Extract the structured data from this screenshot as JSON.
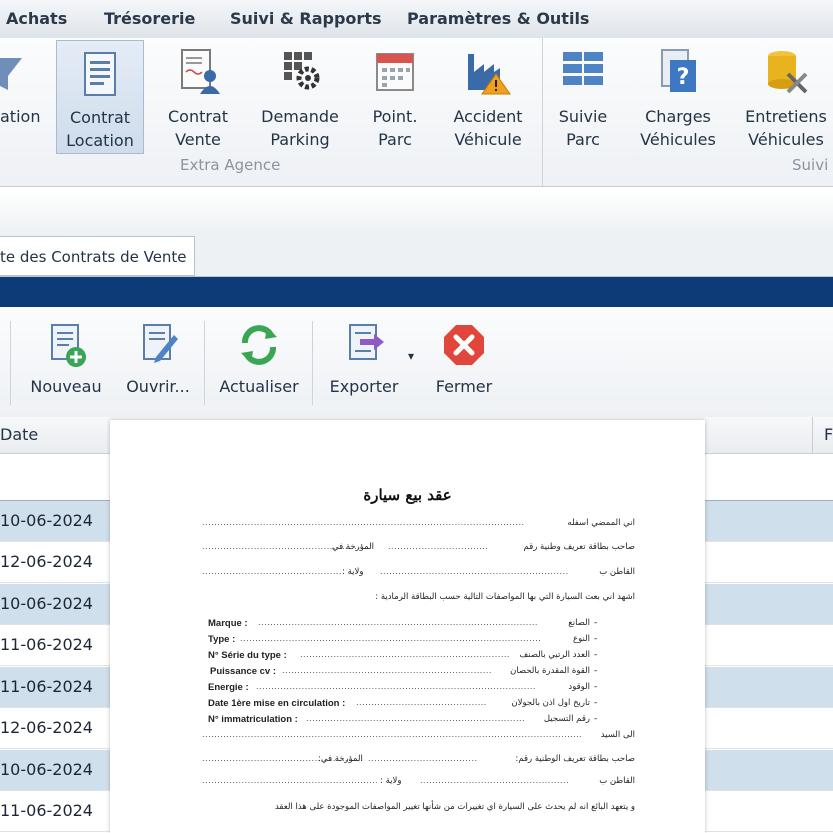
{
  "menu": [
    "Achats",
    "Trésorerie",
    "Suivi & Rapports",
    "Paramètres & Outils"
  ],
  "ribbon": {
    "partial_label": "ation",
    "buttons": [
      {
        "line1": "Contrat",
        "line2": "Location",
        "icon": "document-icon"
      },
      {
        "line1": "Contrat",
        "line2": "Vente",
        "icon": "contract-person-icon"
      },
      {
        "line1": "Demande",
        "line2": "Parking",
        "icon": "parking-gear-icon"
      },
      {
        "line1": "Point.",
        "line2": "Parc",
        "icon": "calendar-icon"
      },
      {
        "line1": "Accident",
        "line2": "Véhicule",
        "icon": "factory-warning-icon"
      },
      {
        "line1": "Suivie",
        "line2": "Parc",
        "icon": "grid-blocks-icon"
      },
      {
        "line1": "Charges",
        "line2": "Véhicules",
        "icon": "help-document-icon"
      },
      {
        "line1": "Entretiens",
        "line2": "Véhicules",
        "icon": "database-tools-icon"
      }
    ],
    "groups": [
      "Extra Agence",
      "Suivi"
    ]
  },
  "tab": {
    "label": "te des Contrats de Vente"
  },
  "toolbar": {
    "buttons": [
      "Nouveau",
      "Ouvrir...",
      "Actualiser",
      "Exporter",
      "Fermer"
    ],
    "dropdown_glyph": "▾"
  },
  "grid": {
    "header_date": "Date",
    "header_right": "F",
    "dates": [
      "10-06-2024",
      "12-06-2024",
      "10-06-2024",
      "11-06-2024",
      "11-06-2024",
      "12-06-2024",
      "10-06-2024",
      "11-06-2024"
    ]
  },
  "document": {
    "title": "عقد بيع سيارة",
    "lines_ar": [
      "اني الممضي اسفله",
      "صاحب بطاقة تعريف وطنية رقم",
      "المؤرخة في",
      "القاطن ب",
      "ولاية :",
      "اشهد اني بعت السيارة التي بها المواصفات التالية حسب البطاقة الرمادية :",
      "الى السيد",
      "صاحب بطاقة تعريف الوطنية رقم:",
      "المؤرخة في:",
      "القاطن ب",
      "ولاية :",
      "و يتعهد البائع انه لم يحدث على السيارة اي تغييرات من شأنها تغيير المواصفات الموجودة على هذا العقد"
    ],
    "specs": [
      {
        "fr": "Marque :",
        "ar": "الصانع"
      },
      {
        "fr": "Type :",
        "ar": "النوع"
      },
      {
        "fr": "N° Série du type :",
        "ar": "العدد الرتبي بالصنف"
      },
      {
        "fr": "Puissance cv :",
        "ar": "القوة المقدرة بالحصان"
      },
      {
        "fr": "Energie :",
        "ar": "الوقود"
      },
      {
        "fr": "Date 1ère mise en circulation :",
        "ar": "تاريخ اول اذن بالجولان"
      },
      {
        "fr": "N° immatriculation :",
        "ar": "رقم التسجيل"
      }
    ]
  },
  "colors": {
    "banner": "#0d3b78",
    "row_alt": "#cfdfeb",
    "selected": "#cfdcec"
  }
}
